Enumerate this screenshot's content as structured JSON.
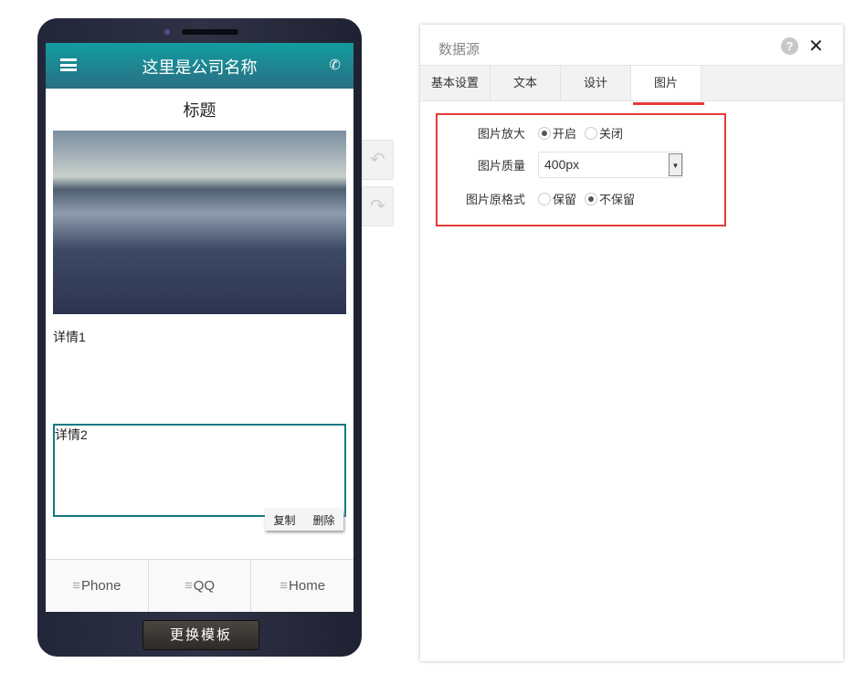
{
  "phone": {
    "company_name": "这里是公司名称",
    "page_title": "标题",
    "detail1": "详情1",
    "detail2": "详情2",
    "copy_label": "复制",
    "delete_label": "删除",
    "footer": [
      {
        "label": "Phone"
      },
      {
        "label": "QQ"
      },
      {
        "label": "Home"
      }
    ],
    "change_template": "更换模板"
  },
  "panel": {
    "title": "数据源",
    "help": "?",
    "close": "✕",
    "tabs": [
      {
        "label": "基本设置"
      },
      {
        "label": "文本"
      },
      {
        "label": "设计"
      },
      {
        "label": "图片",
        "active": true
      }
    ],
    "form": {
      "zoom_label": "图片放大",
      "zoom_on": "开启",
      "zoom_off": "关闭",
      "quality_label": "图片质量",
      "quality_value": "400px",
      "format_label": "图片原格式",
      "keep": "保留",
      "no_keep": "不保留"
    }
  },
  "colors": {
    "accent": "#e8393b",
    "header": "#119d9f"
  }
}
